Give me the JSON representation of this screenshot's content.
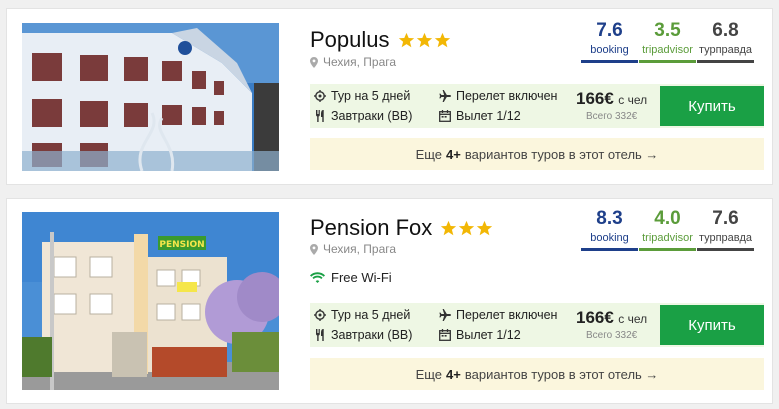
{
  "hotels": [
    {
      "name": "Populus",
      "stars": 3,
      "location": "Чехия, Прага",
      "ratings": [
        {
          "value": "7.6",
          "label": "booking"
        },
        {
          "value": "3.5",
          "label": "tripadvisor"
        },
        {
          "value": "6.8",
          "label": "турправда"
        }
      ],
      "wifi": "",
      "offer": {
        "tour": "Тур на 5 дней",
        "meals": "Завтраки (BB)",
        "flight": "Перелет включен",
        "departure": "Вылет 1/12",
        "price": "166€",
        "price_unit": "с чел",
        "total": "Всего 332€",
        "buy_label": "Купить"
      },
      "more": {
        "prefix": "Еще",
        "count": "4+",
        "suffix": "вариантов туров в этот отель →"
      }
    },
    {
      "name": "Pension Fox",
      "stars": 3,
      "location": "Чехия, Прага",
      "ratings": [
        {
          "value": "8.3",
          "label": "booking"
        },
        {
          "value": "4.0",
          "label": "tripadvisor"
        },
        {
          "value": "7.6",
          "label": "турправда"
        }
      ],
      "wifi": "Free Wi-Fi",
      "offer": {
        "tour": "Тур на 5 дней",
        "meals": "Завтраки (BB)",
        "flight": "Перелет включен",
        "departure": "Вылет 1/12",
        "price": "166€",
        "price_unit": "с чел",
        "total": "Всего 332€",
        "buy_label": "Купить"
      },
      "more": {
        "prefix": "Еще",
        "count": "4+",
        "suffix": "вариантов туров в этот отель →"
      },
      "photo_sign": "PENSION"
    }
  ],
  "colors": {
    "booking": "#1e3f8a",
    "tripadvisor": "#5b9c3a",
    "turpravda": "#444444",
    "buy_button": "#1aa045",
    "star": "#f2b705",
    "offer_bg": "#eef7e4",
    "more_bg": "#fbf6dd"
  },
  "icons": [
    "star-icon",
    "map-pin-icon",
    "gear-icon",
    "fork-knife-icon",
    "plane-icon",
    "calendar-icon",
    "wifi-icon"
  ]
}
